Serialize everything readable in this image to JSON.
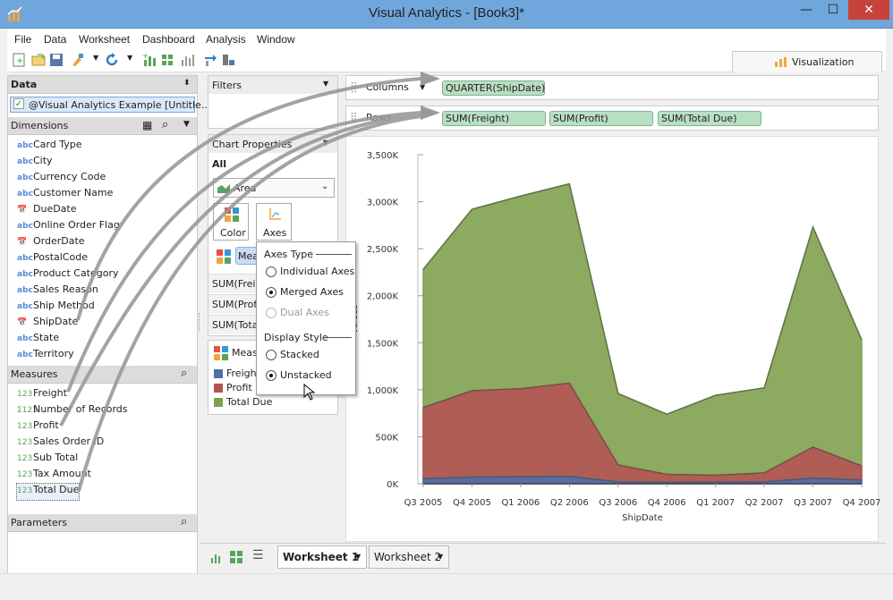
{
  "window": {
    "title": "Visual Analytics - [Book3]*",
    "minimize": "—",
    "maximize": "☐",
    "close": "✕"
  },
  "menu": [
    "File",
    "Data",
    "Worksheet",
    "Dashboard",
    "Analysis",
    "Window"
  ],
  "viz_tab": {
    "label": "Visualization"
  },
  "data_panel": {
    "header": "Data",
    "source": "@Visual Analytics Example [Untitle...",
    "dimensions_header": "Dimensions",
    "dimensions": [
      {
        "icon": "abc",
        "label": "Card Type"
      },
      {
        "icon": "abc",
        "label": "City"
      },
      {
        "icon": "abc",
        "label": "Currency Code"
      },
      {
        "icon": "abc",
        "label": "Customer Name"
      },
      {
        "icon": "date",
        "label": "DueDate"
      },
      {
        "icon": "abc",
        "label": "Online Order Flag"
      },
      {
        "icon": "date",
        "label": "OrderDate"
      },
      {
        "icon": "abc",
        "label": "PostalCode"
      },
      {
        "icon": "abc",
        "label": "Product Category"
      },
      {
        "icon": "abc",
        "label": "Sales Reason"
      },
      {
        "icon": "abc",
        "label": "Ship Method"
      },
      {
        "icon": "date",
        "label": "ShipDate"
      },
      {
        "icon": "abc",
        "label": "State"
      },
      {
        "icon": "abc",
        "label": "Territory"
      }
    ],
    "measures_header": "Measures",
    "measures": [
      {
        "icon": "123",
        "label": "Freight"
      },
      {
        "icon": "Σ123",
        "label": "Number of Records"
      },
      {
        "icon": "123",
        "label": "Profit"
      },
      {
        "icon": "123",
        "label": "Sales Order ID"
      },
      {
        "icon": "123",
        "label": "Sub Total"
      },
      {
        "icon": "123",
        "label": "Tax Amount"
      },
      {
        "icon": "123",
        "label": "Total Due"
      }
    ],
    "parameters_header": "Parameters"
  },
  "filters": {
    "header": "Filters"
  },
  "chart_properties": {
    "header": "Chart Properties",
    "all_label": "All",
    "chart_type": "Area",
    "color_label": "Color",
    "axes_label": "Axes",
    "measure_chip": "Mea",
    "rows": [
      "SUM(Freig",
      "SUM(Profi",
      "SUM(Tota"
    ],
    "legend_header": "Measu",
    "legend": [
      {
        "label": "Freight",
        "color": "#4f6fa8"
      },
      {
        "label": "Profit",
        "color": "#b35454"
      },
      {
        "label": "Total Due",
        "color": "#7fa14f"
      }
    ]
  },
  "axes_popup": {
    "axes_type_label": "Axes Type",
    "options_axes": [
      {
        "label": "Individual Axes",
        "state": "off"
      },
      {
        "label": "Merged Axes",
        "state": "on"
      },
      {
        "label": "Dual Axes",
        "state": "disabled"
      }
    ],
    "display_style_label": "Display Style",
    "options_display": [
      {
        "label": "Stacked",
        "state": "off"
      },
      {
        "label": "Unstacked",
        "state": "on"
      }
    ]
  },
  "shelves": {
    "columns_label": "Columns",
    "columns_pills": [
      "QUARTER(ShipDate)"
    ],
    "rows_label": "Rows",
    "rows_pills": [
      "SUM(Freight)",
      "SUM(Profit)",
      "SUM(Total Due)"
    ]
  },
  "chart_data": {
    "type": "area",
    "xlabel": "ShipDate",
    "ylabel": "Values",
    "categories": [
      "Q3 2005",
      "Q4 2005",
      "Q1 2006",
      "Q2 2006",
      "Q3 2006",
      "Q4 2006",
      "Q1 2007",
      "Q2 2007",
      "Q3 2007",
      "Q4 2007"
    ],
    "ylim": [
      0,
      3500
    ],
    "yticks": [
      "0K",
      "500K",
      "1,000K",
      "1,500K",
      "2,000K",
      "2,500K",
      "3,000K",
      "3,500K"
    ],
    "stacked": false,
    "series": [
      {
        "name": "Total Due",
        "color": "#7fa14f",
        "values": [
          2280,
          2920,
          3060,
          3190,
          960,
          740,
          940,
          1020,
          2730,
          1530
        ]
      },
      {
        "name": "Profit",
        "color": "#b35454",
        "values": [
          810,
          990,
          1010,
          1070,
          200,
          100,
          90,
          115,
          390,
          190
        ]
      },
      {
        "name": "Freight",
        "color": "#4f6fa8",
        "values": [
          55,
          70,
          75,
          78,
          20,
          15,
          18,
          20,
          60,
          40
        ]
      }
    ]
  },
  "worksheets": {
    "tabs": [
      "Worksheet 1",
      "Worksheet 2"
    ],
    "active": 0
  }
}
